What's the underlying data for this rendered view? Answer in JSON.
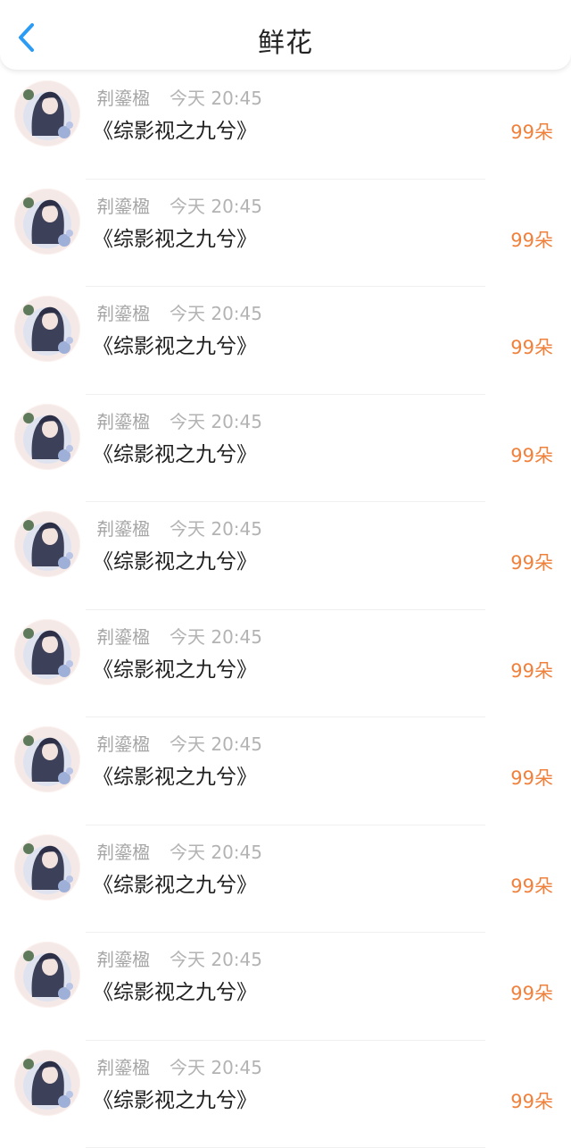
{
  "header": {
    "back_icon": "chevron-left-icon",
    "title": "鲜花",
    "accent": "#2b9bf4"
  },
  "colors": {
    "flower_count": "#f0813c",
    "meta_text": "#a6a6a6"
  },
  "records": [
    {
      "user": "㓫鎏楹",
      "time": "今天 20:45",
      "book": "《综影视之九兮》",
      "amount": "99朵"
    },
    {
      "user": "㓫鎏楹",
      "time": "今天 20:45",
      "book": "《综影视之九兮》",
      "amount": "99朵"
    },
    {
      "user": "㓫鎏楹",
      "time": "今天 20:45",
      "book": "《综影视之九兮》",
      "amount": "99朵"
    },
    {
      "user": "㓫鎏楹",
      "time": "今天 20:45",
      "book": "《综影视之九兮》",
      "amount": "99朵"
    },
    {
      "user": "㓫鎏楹",
      "time": "今天 20:45",
      "book": "《综影视之九兮》",
      "amount": "99朵"
    },
    {
      "user": "㓫鎏楹",
      "time": "今天 20:45",
      "book": "《综影视之九兮》",
      "amount": "99朵"
    },
    {
      "user": "㓫鎏楹",
      "time": "今天 20:45",
      "book": "《综影视之九兮》",
      "amount": "99朵"
    },
    {
      "user": "㓫鎏楹",
      "time": "今天 20:45",
      "book": "《综影视之九兮》",
      "amount": "99朵"
    },
    {
      "user": "㓫鎏楹",
      "time": "今天 20:45",
      "book": "《综影视之九兮》",
      "amount": "99朵"
    },
    {
      "user": "㓫鎏楹",
      "time": "今天 20:45",
      "book": "《综影视之九兮》",
      "amount": "99朵"
    }
  ]
}
